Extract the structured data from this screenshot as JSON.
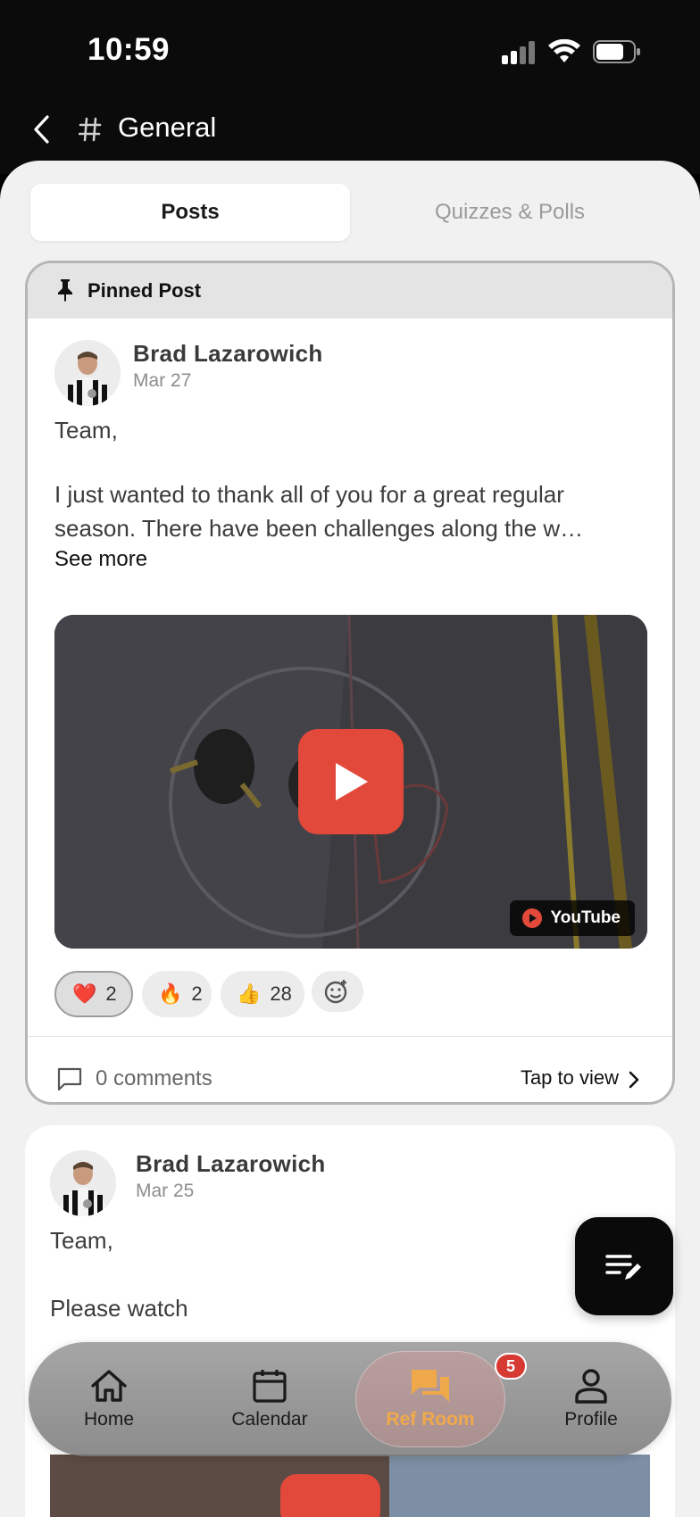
{
  "status_bar": {
    "time": "10:59"
  },
  "header": {
    "title": "General"
  },
  "tabs": [
    {
      "label": "Posts",
      "active": true
    },
    {
      "label": "Quizzes & Polls",
      "active": false
    }
  ],
  "pinned": {
    "label": "Pinned Post",
    "post": {
      "author": "Brad Lazarowich",
      "date": "Mar 27",
      "greeting": "Team,",
      "body": "I just wanted to thank all of you for a great regular season. There have been challenges along the w…",
      "see_more": "See more",
      "video_badge": "YouTube",
      "reactions": [
        {
          "emoji": "❤️",
          "count": "2",
          "active": true
        },
        {
          "emoji": "🔥",
          "count": "2",
          "active": false
        },
        {
          "emoji": "👍",
          "count": "28",
          "active": false
        }
      ],
      "comments": "0 comments",
      "tap_to_view": "Tap to view"
    }
  },
  "second_post": {
    "author": "Brad Lazarowich",
    "date": "Mar 25",
    "greeting": "Team,",
    "body": "Please watch"
  },
  "bottom_nav": {
    "items": [
      {
        "label": "Home",
        "icon": "home-icon"
      },
      {
        "label": "Calendar",
        "icon": "calendar-icon"
      },
      {
        "label": "Ref Room",
        "icon": "chat-icon",
        "active": true
      },
      {
        "label": "Profile",
        "icon": "person-icon"
      }
    ],
    "badge": "5"
  },
  "colors": {
    "accent": "#e2493a",
    "active_nav": "#f0a94a",
    "badge": "#d63a32"
  }
}
